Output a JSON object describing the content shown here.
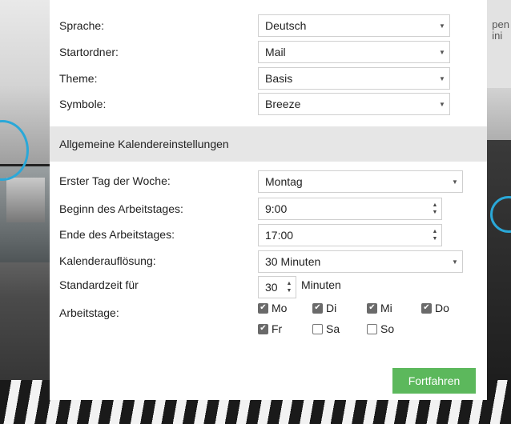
{
  "settings": {
    "language_label": "Sprache:",
    "language_value": "Deutsch",
    "start_folder_label": "Startordner:",
    "start_folder_value": "Mail",
    "theme_label": "Theme:",
    "theme_value": "Basis",
    "icons_label": "Symbole:",
    "icons_value": "Breeze"
  },
  "calendar": {
    "section_title": "Allgemeine Kalendereinstellungen",
    "first_day_label": "Erster Tag der Woche:",
    "first_day_value": "Montag",
    "work_start_label": "Beginn des Arbeitstages:",
    "work_start_value": "9:00",
    "work_end_label": "Ende des Arbeitstages:",
    "work_end_value": "17:00",
    "resolution_label": "Kalenderauflösung:",
    "resolution_value": "30 Minuten",
    "default_time_label": "Standardzeit für",
    "default_time_value": "30",
    "default_time_unit": "Minuten",
    "workdays_label": "Arbeitstage:",
    "days": [
      {
        "label": "Mo",
        "checked": true
      },
      {
        "label": "Di",
        "checked": true
      },
      {
        "label": "Mi",
        "checked": true
      },
      {
        "label": "Do",
        "checked": true
      },
      {
        "label": "Fr",
        "checked": true
      },
      {
        "label": "Sa",
        "checked": false
      },
      {
        "label": "So",
        "checked": false
      }
    ]
  },
  "actions": {
    "continue_label": "Fortfahren"
  },
  "background": {
    "right_text": "pen ini"
  },
  "colors": {
    "accent_button": "#5cb85c",
    "section_bg": "#e6e6e6",
    "swirl": "#2aa8d8"
  }
}
